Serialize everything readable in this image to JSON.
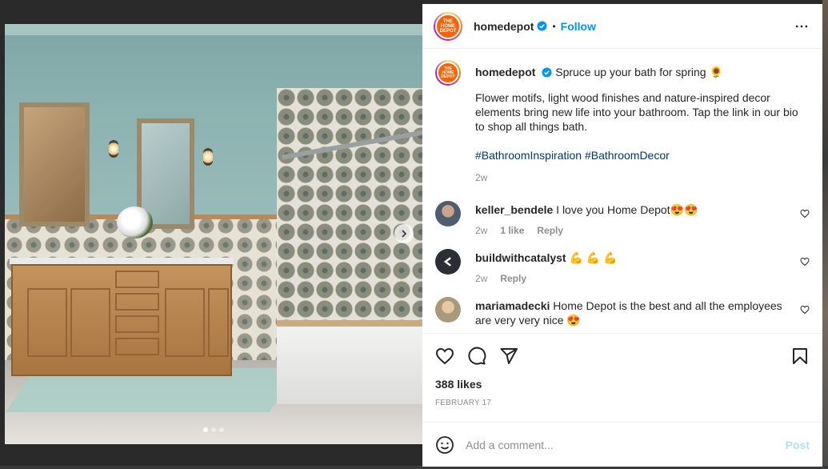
{
  "post": {
    "handle": "homedepot",
    "follow_label": "Follow",
    "separator": "•",
    "avatar_text": "THE HOME DEPOT",
    "caption_handle": "homedepot",
    "caption_title": "Spruce up your bath for spring 🌻",
    "caption_body": "Flower motifs, light wood finishes and nature-inspired decor elements bring new life into your bathroom. Tap the link in our bio to shop all things bath.",
    "caption_tags": "#BathroomInspiration #BathroomDecor",
    "caption_time": "2w",
    "likes": "388 likes",
    "date": "FEBRUARY 17"
  },
  "comments": [
    {
      "user": "keller_bendele",
      "text": "I love you Home Depot😍😍",
      "time": "2w",
      "likes": "1 like",
      "reply": "Reply",
      "avatar_color": "#6b7a8c"
    },
    {
      "user": "buildwithcatalyst",
      "text": "💪 💪 💪",
      "time": "2w",
      "likes": "",
      "reply": "Reply",
      "avatar_color": "#2b2f33"
    },
    {
      "user": "mariamadecki",
      "text": "Home Depot is the best and all the employees are very very nice 😍",
      "time": "",
      "likes": "",
      "reply": "",
      "avatar_color": "#a89a7a"
    }
  ],
  "compose": {
    "placeholder": "Add a comment...",
    "post_label": "Post"
  },
  "carousel": {
    "slides": 3,
    "active": 1
  },
  "icons": {
    "more": "more-horizontal-icon",
    "verified": "verified-badge-icon",
    "like": "heart-icon",
    "comment": "comment-icon",
    "share": "send-icon",
    "save": "bookmark-icon",
    "emoji": "smiley-icon",
    "next": "chevron-right-icon"
  },
  "colors": {
    "accent": "#0095f6",
    "brand": "#f96302",
    "post_disabled": "#b2dffc",
    "hashtag": "#00376b"
  }
}
